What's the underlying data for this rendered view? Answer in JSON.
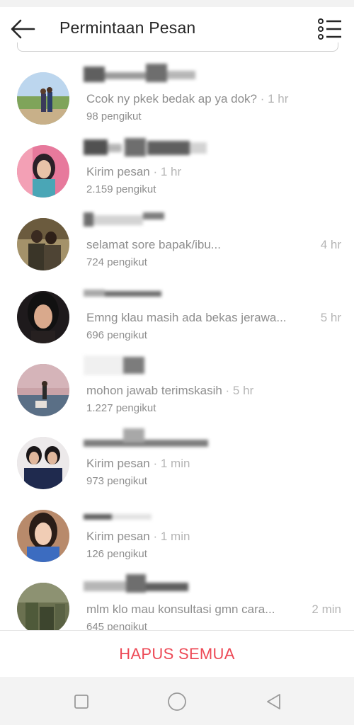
{
  "header": {
    "title": "Permintaan Pesan",
    "back_icon": "arrow-left-icon",
    "menu_icon": "list-menu-icon"
  },
  "requests": [
    {
      "message": "Ccok ny pkek bedak ap ya dok?",
      "time": "· 1 hr",
      "followers": "98 pengikut"
    },
    {
      "message": "Kirim pesan",
      "time": "· 1 hr",
      "followers": "2.159 pengikut"
    },
    {
      "message": "selamat sore bapak/ibu...",
      "time": "4 hr",
      "followers": "724 pengikut"
    },
    {
      "message": "Emng klau masih ada bekas jerawa...",
      "time": "5 hr",
      "followers": "696 pengikut"
    },
    {
      "message": "mohon jawab terimskasih",
      "time": "· 5 hr",
      "followers": "1.227 pengikut"
    },
    {
      "message": "Kirim pesan",
      "time": "· 1 min",
      "followers": "973 pengikut"
    },
    {
      "message": "Kirim pesan",
      "time": "· 1 min",
      "followers": "126 pengikut"
    },
    {
      "message": "mlm klo mau konsultasi gmn cara...",
      "time": "2 min",
      "followers": "645 pengikut"
    }
  ],
  "footer": {
    "delete_all_label": "HAPUS SEMUA"
  },
  "colors": {
    "accent_red": "#ed4956",
    "text_gray": "#8e8e8e",
    "time_gray": "#b5b5b5"
  },
  "system_nav": {
    "recent": "square-icon",
    "home": "circle-icon",
    "back": "triangle-back-icon"
  }
}
